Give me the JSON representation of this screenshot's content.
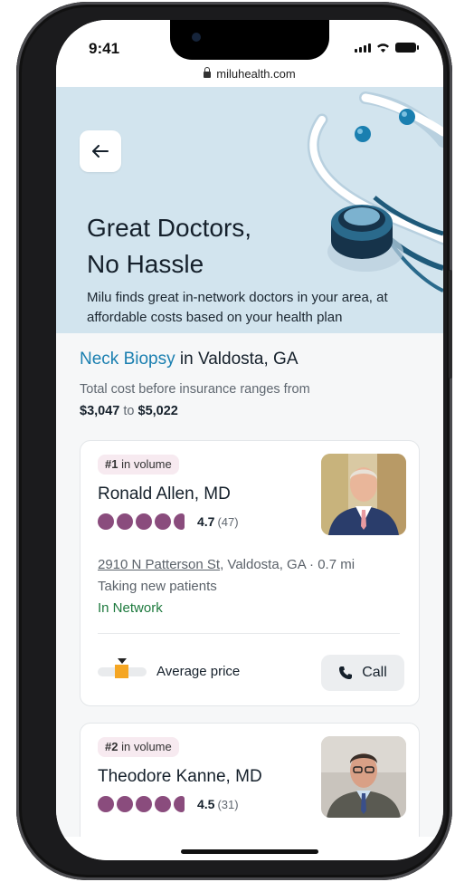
{
  "status_bar": {
    "time": "9:41"
  },
  "browser": {
    "url": "miluhealth.com"
  },
  "hero": {
    "title_line1": "Great Doctors,",
    "title_line2": "No Hassle",
    "subtitle": "Milu finds great in-network doctors in your area, at affordable costs based on your health plan"
  },
  "search": {
    "procedure": "Neck Biopsy",
    "location": "in Valdosta, GA",
    "cost_prefix": "Total cost before insurance ranges from",
    "cost_low": "$3,047",
    "cost_to": "to",
    "cost_high": "$5,022"
  },
  "doctors": [
    {
      "rank": "#1",
      "rank_label": "in volume",
      "name": "Ronald Allen, MD",
      "rating": "4.7",
      "reviews": "(47)",
      "address": "2910 N Patterson St",
      "city": ", Valdosta, GA",
      "distance": "· 0.7 mi",
      "status": "Taking new patients",
      "network": "In Network",
      "price_label": "Average price",
      "call_label": "Call"
    },
    {
      "rank": "#2",
      "rank_label": "in volume",
      "name": "Theodore Kanne, MD",
      "rating": "4.5",
      "reviews": "(31)"
    }
  ],
  "colors": {
    "hero_bg": "#d2e4ee",
    "procedure_link": "#1a7fb0",
    "rating_dot": "#8a4c7d",
    "in_network": "#1e7a3e",
    "price_marker": "#f5a623"
  },
  "icons": [
    "back-arrow-icon",
    "lock-icon",
    "signal-icon",
    "wifi-icon",
    "battery-icon",
    "phone-icon",
    "stethoscope-illustration"
  ]
}
